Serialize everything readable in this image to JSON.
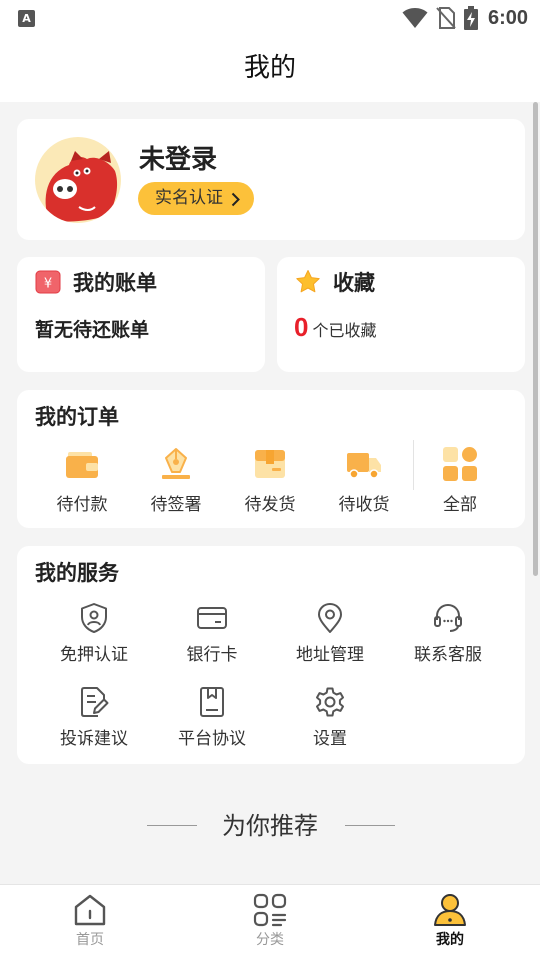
{
  "status_bar": {
    "app_glyph": "A",
    "time": "6:00"
  },
  "header": {
    "title": "我的"
  },
  "profile": {
    "name": "未登录",
    "verify_label": "实名认证"
  },
  "bill": {
    "title": "我的账单",
    "subtitle": "暂无待还账单",
    "icon": "bill-icon",
    "icon_glyph": "¥"
  },
  "favorites": {
    "title": "收藏",
    "count": "0",
    "label": "个已收藏",
    "icon": "star-icon"
  },
  "orders": {
    "title": "我的订单",
    "items": [
      {
        "label": "待付款",
        "icon": "wallet-icon"
      },
      {
        "label": "待签署",
        "icon": "sign-pen-icon"
      },
      {
        "label": "待发货",
        "icon": "box-icon"
      },
      {
        "label": "待收货",
        "icon": "truck-icon"
      },
      {
        "label": "全部",
        "icon": "grid-icon"
      }
    ]
  },
  "services": {
    "title": "我的服务",
    "items": [
      {
        "label": "免押认证",
        "icon": "shield-user-icon"
      },
      {
        "label": "银行卡",
        "icon": "card-icon"
      },
      {
        "label": "地址管理",
        "icon": "location-icon"
      },
      {
        "label": "联系客服",
        "icon": "headset-icon"
      },
      {
        "label": "投诉建议",
        "icon": "document-edit-icon"
      },
      {
        "label": "平台协议",
        "icon": "book-icon"
      },
      {
        "label": "设置",
        "icon": "gear-icon"
      }
    ]
  },
  "recommend": {
    "title": "为你推荐"
  },
  "tabbar": {
    "items": [
      {
        "label": "首页",
        "icon": "home-icon",
        "active": false
      },
      {
        "label": "分类",
        "icon": "category-icon",
        "active": false
      },
      {
        "label": "我的",
        "icon": "user-icon",
        "active": true
      }
    ]
  },
  "colors": {
    "accent": "#fcc13a",
    "orange": "#f9b14a",
    "red": "#e8202a",
    "background": "#f4f4f4"
  }
}
